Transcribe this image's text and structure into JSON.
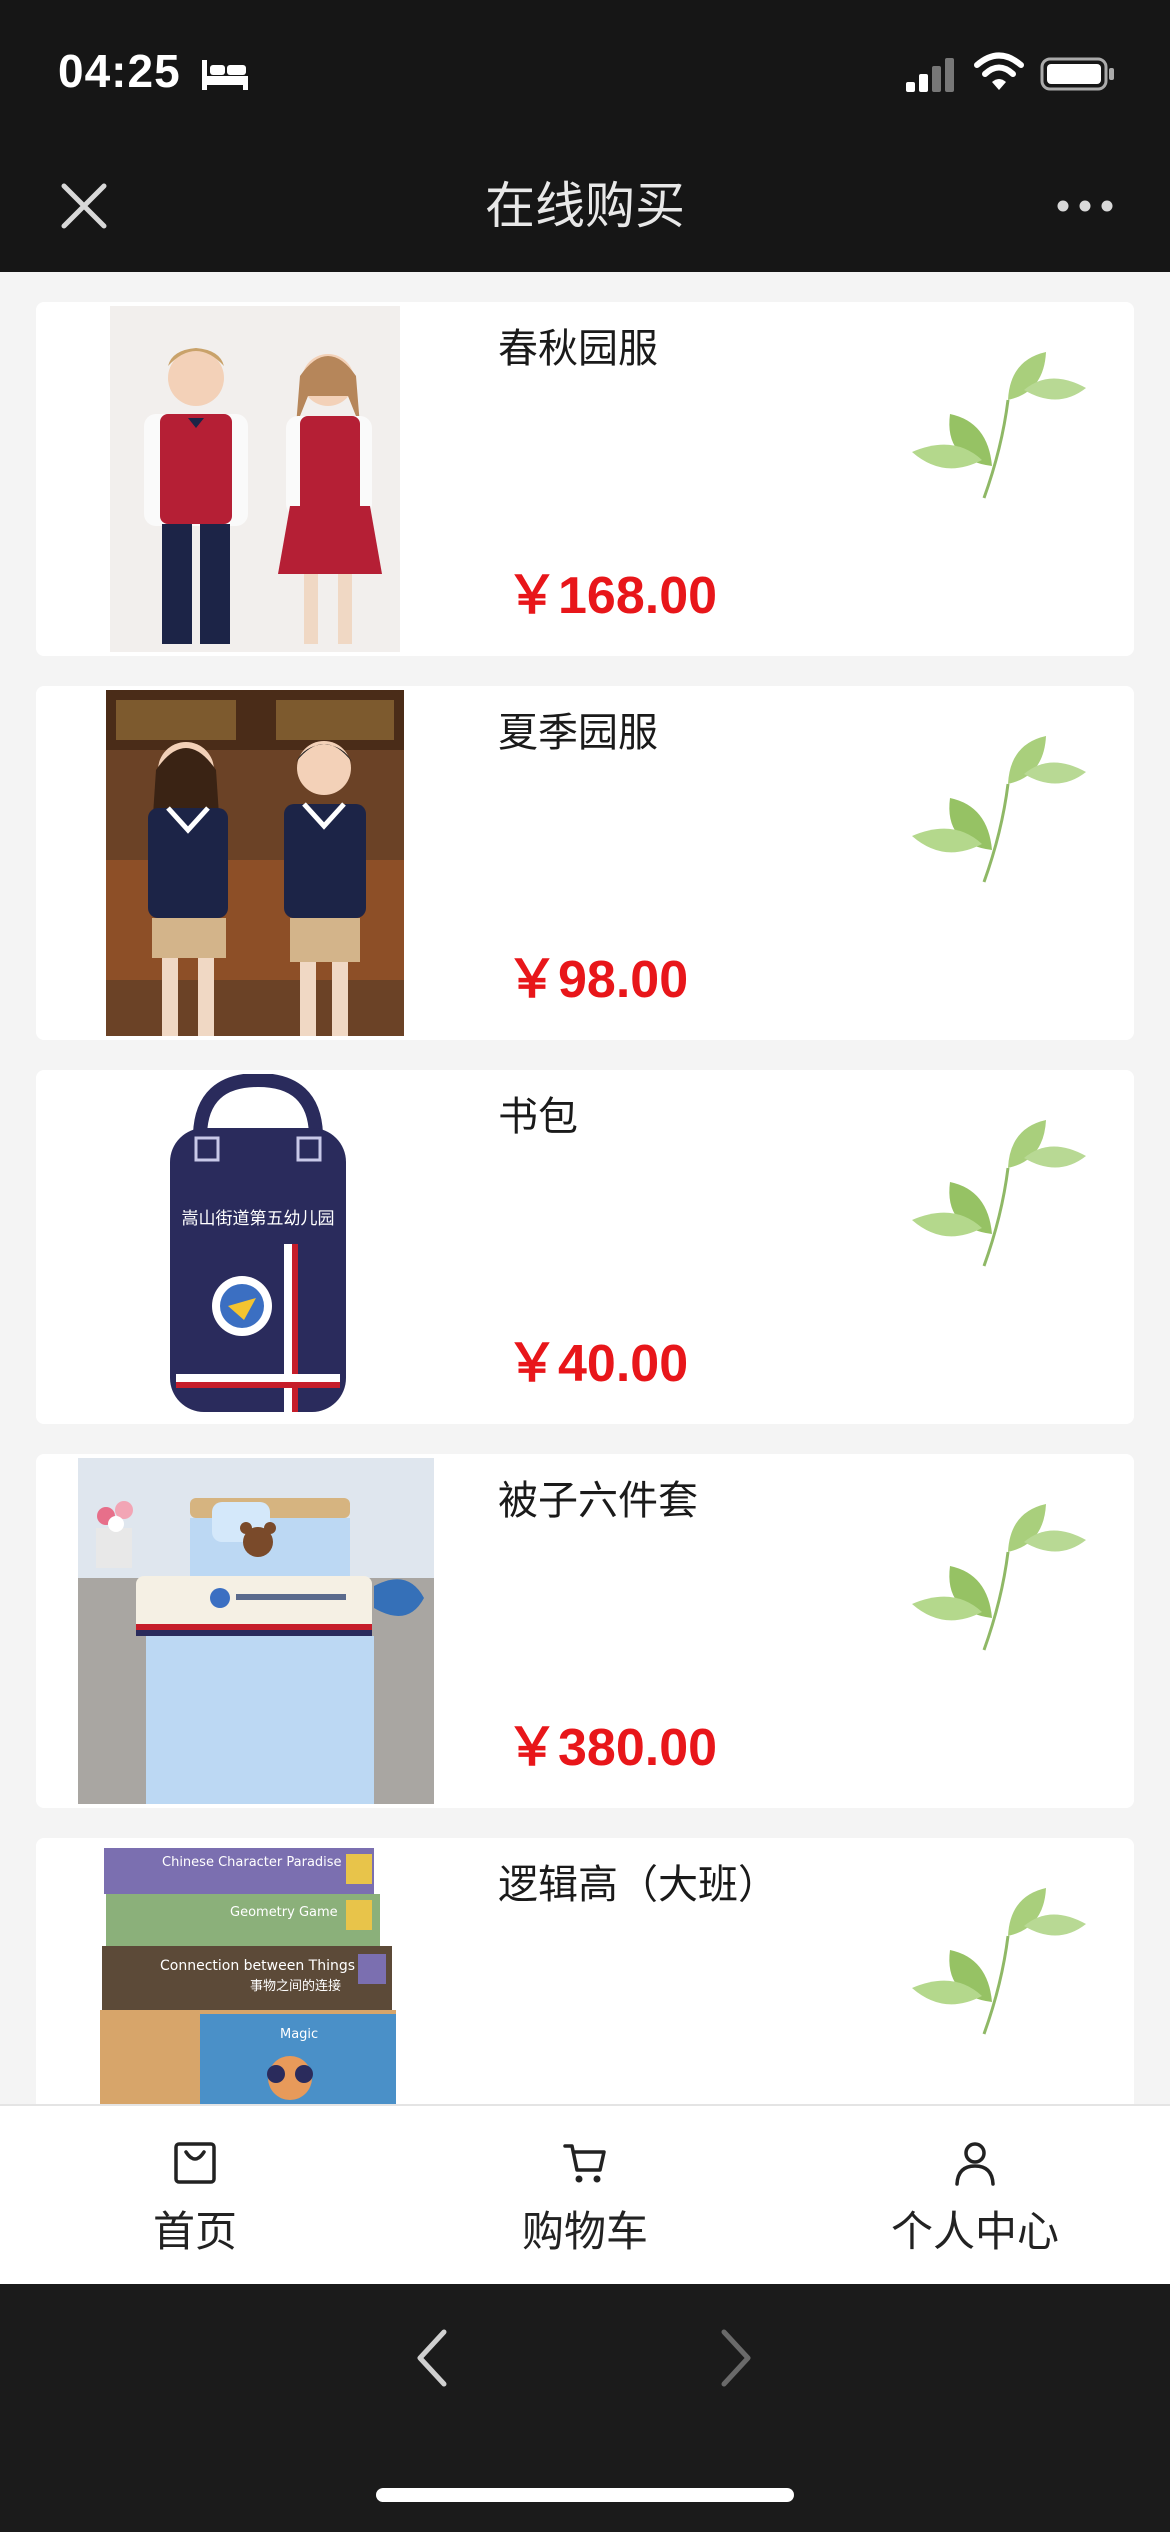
{
  "status_bar": {
    "time": "04:25",
    "icons": [
      "bed-icon",
      "signal-icon",
      "wifi-icon",
      "battery-icon"
    ]
  },
  "nav": {
    "title": "在线购买",
    "left_icon": "close-icon",
    "right_icon": "more-icon"
  },
  "products": [
    {
      "name": "春秋园服",
      "price": "￥168.00",
      "image": "kids-red-vest-uniform"
    },
    {
      "name": "夏季园服",
      "price": "￥98.00",
      "image": "kids-navy-polo-uniform"
    },
    {
      "name": "书包",
      "price": "￥40.00",
      "image": "navy-school-backpack",
      "image_text": "嵩山街道第五幼儿园"
    },
    {
      "name": "被子六件套",
      "price": "￥380.00",
      "image": "light-blue-bedding-set"
    },
    {
      "name": "逻辑高（大班）",
      "price": "",
      "image": "logic-books-stack",
      "image_text": [
        "Chinese Character Paradise",
        "Geometry Game",
        "Connection between Things",
        "事物之间的连接",
        "Magic"
      ]
    }
  ],
  "decoration": {
    "card_icon": "leaf-icon"
  },
  "tab_bar": {
    "items": [
      {
        "label": "首页",
        "icon": "bag-icon"
      },
      {
        "label": "购物车",
        "icon": "cart-icon"
      },
      {
        "label": "个人中心",
        "icon": "person-icon"
      }
    ]
  },
  "browser": {
    "back_icon": "chevron-left-icon",
    "forward_icon": "chevron-right-icon"
  },
  "colors": {
    "bar_bg": "#161616",
    "page_bg": "#f4f4f4",
    "price": "#e8161a",
    "uniform_red": "#b51f35",
    "uniform_navy": "#1c2447",
    "bedding_blue": "#bfd8f2",
    "leaf_green": "#9bc56d"
  }
}
